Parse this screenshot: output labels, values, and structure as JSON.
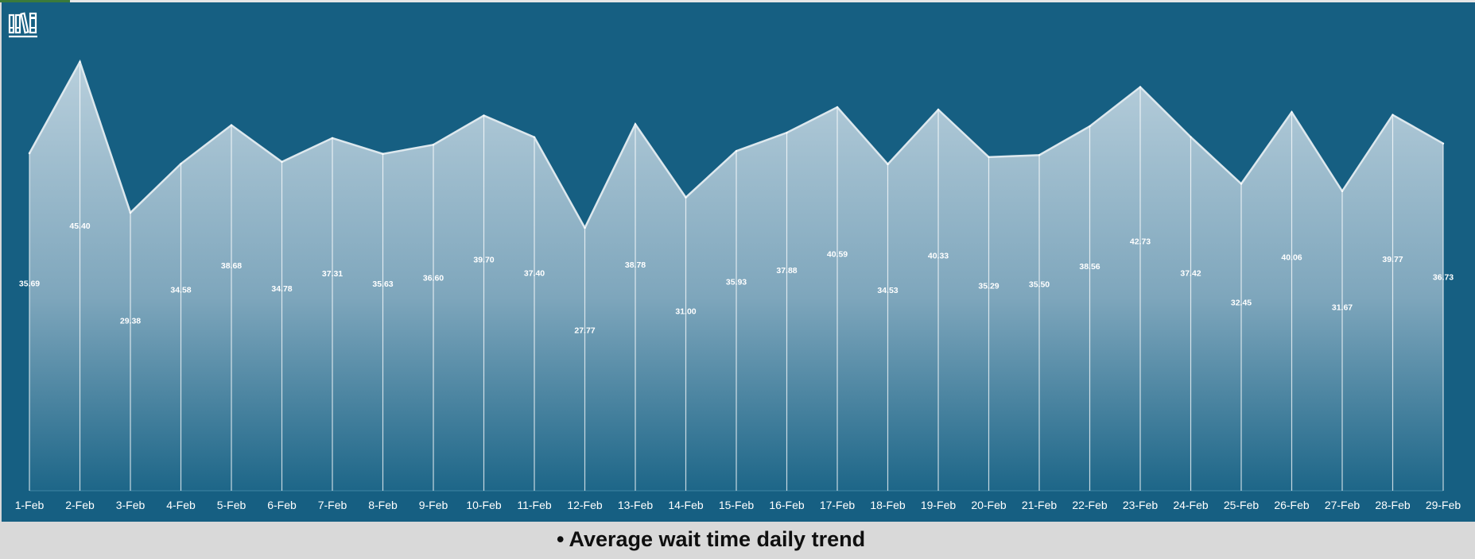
{
  "footer": {
    "bullet": "•",
    "title": "Average wait time daily trend"
  },
  "icons": {
    "logo": "library-books-icon"
  },
  "colors": {
    "background": "#165f82",
    "area_top": "#a9c4d3",
    "area_bottom": "#165f82",
    "line": "#e6eef3",
    "label": "#ffffff",
    "footer_bg": "#d9d9d9",
    "footer_text": "#0f0f0f"
  },
  "chart_data": {
    "type": "area",
    "title": "",
    "xlabel": "",
    "ylabel": "",
    "grid": false,
    "legend": "none",
    "ylim": [
      0,
      48
    ],
    "categories": [
      "1-Feb",
      "2-Feb",
      "3-Feb",
      "4-Feb",
      "5-Feb",
      "6-Feb",
      "7-Feb",
      "8-Feb",
      "9-Feb",
      "10-Feb",
      "11-Feb",
      "12-Feb",
      "13-Feb",
      "14-Feb",
      "15-Feb",
      "16-Feb",
      "17-Feb",
      "18-Feb",
      "19-Feb",
      "20-Feb",
      "21-Feb",
      "22-Feb",
      "23-Feb",
      "24-Feb",
      "25-Feb",
      "26-Feb",
      "27-Feb",
      "28-Feb",
      "29-Feb"
    ],
    "values": [
      35.69,
      45.4,
      29.38,
      34.58,
      38.68,
      34.78,
      37.31,
      35.63,
      36.6,
      39.7,
      37.4,
      27.77,
      38.78,
      31.0,
      35.93,
      37.88,
      40.59,
      34.53,
      40.33,
      35.29,
      35.5,
      38.56,
      42.73,
      37.42,
      32.45,
      40.06,
      31.67,
      39.77,
      36.73
    ],
    "data_labels": [
      "35.69",
      "45.40",
      "29.38",
      "34.58",
      "38.68",
      "34.78",
      "37.31",
      "35.63",
      "36.60",
      "39.70",
      "37.40",
      "27.77",
      "38.78",
      "31.00",
      "35.93",
      "37.88",
      "40.59",
      "34.53",
      "40.33",
      "35.29",
      "35.50",
      "38.56",
      "42.73",
      "37.42",
      "32.45",
      "40.06",
      "31.67",
      "39.77",
      "36.73"
    ]
  }
}
